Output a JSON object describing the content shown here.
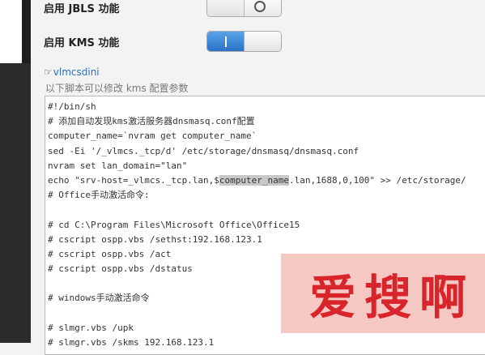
{
  "settings": {
    "jbls": {
      "label": "启用 JBLS 功能",
      "state": "off"
    },
    "kms": {
      "label": "启用 KMS 功能",
      "state": "on"
    }
  },
  "script_section": {
    "link_icon": "pointing-hand-icon",
    "link_label": "vlmcsdini",
    "hint": "以下脚本可以修改 kms 配置参数"
  },
  "editor": {
    "lines": [
      "#!/bin/sh",
      "# 添加自动发现kms激活服务器dnsmasq.conf配置",
      "computer_name=`nvram get computer_name`",
      "sed -Ei '/_vlmcs._tcp/d' /etc/storage/dnsmasq/dnsmasq.conf",
      "nvram set lan_domain=\"lan\"",
      "echo \"srv-host=_vlmcs._tcp.lan,$computer_name.lan,1688,0,100\" >> /etc/storage/",
      "# Office手动激活命令:",
      "",
      "# cd C:\\Program Files\\Microsoft Office\\Office15",
      "# cscript ospp.vbs /sethst:192.168.123.1",
      "# cscript ospp.vbs /act",
      "# cscript ospp.vbs /dstatus",
      "",
      "# windows手动激活命令",
      "",
      "# slmgr.vbs /upk",
      "# slmgr.vbs /skms 192.168.123.1"
    ],
    "selected_text": "computer_name"
  },
  "watermark": {
    "text": "爱搜啊"
  },
  "colors": {
    "accent": "#2a72c6",
    "link": "#2a6fbf",
    "watermark_bg": "#f5c3be",
    "watermark_text": "#d8242b"
  }
}
